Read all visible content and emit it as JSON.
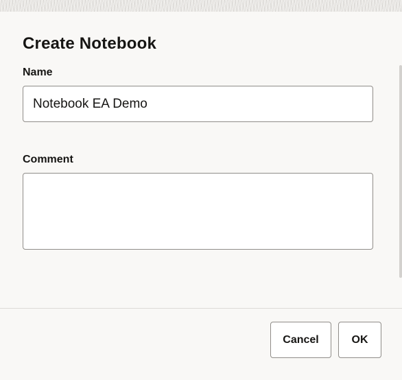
{
  "dialog": {
    "title": "Create Notebook",
    "name_label": "Name",
    "name_value": "Notebook EA Demo",
    "comment_label": "Comment",
    "comment_value": ""
  },
  "footer": {
    "cancel_label": "Cancel",
    "ok_label": "OK"
  }
}
